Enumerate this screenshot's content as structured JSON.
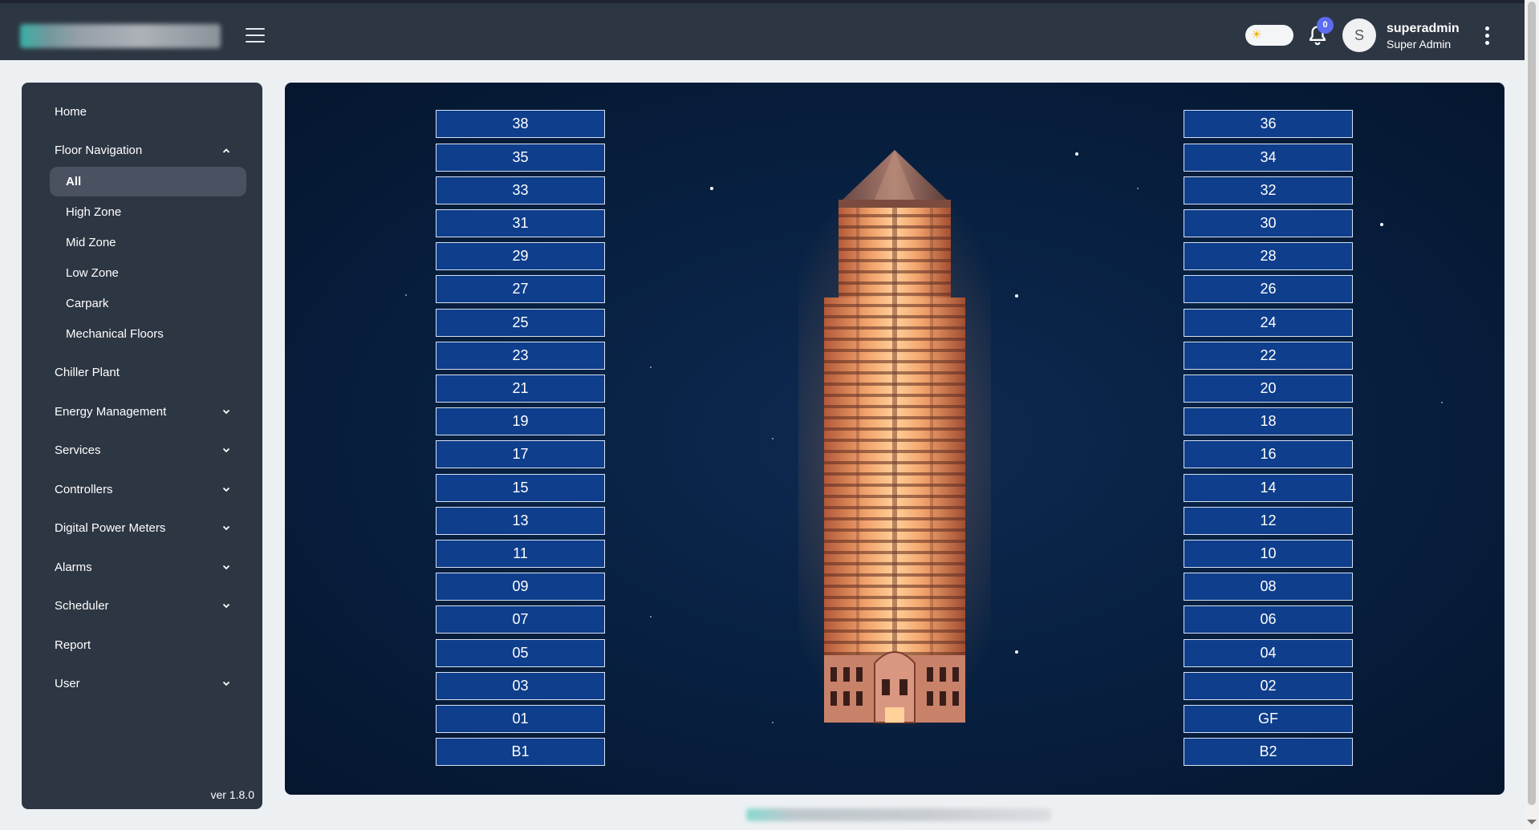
{
  "header": {
    "theme_toggle_icon": "sun-icon",
    "notifications": {
      "count": "0"
    },
    "user": {
      "initial": "S",
      "name": "superadmin",
      "role": "Super Admin"
    }
  },
  "sidebar": {
    "items": [
      {
        "label": "Home"
      },
      {
        "label": "Floor Navigation"
      },
      {
        "label": "Chiller Plant"
      },
      {
        "label": "Energy Management"
      },
      {
        "label": "Services"
      },
      {
        "label": "Controllers"
      },
      {
        "label": "Digital Power Meters"
      },
      {
        "label": "Alarms"
      },
      {
        "label": "Scheduler"
      },
      {
        "label": "Report"
      },
      {
        "label": "User"
      }
    ],
    "floor_nav_sub": [
      {
        "label": "All"
      },
      {
        "label": "High Zone"
      },
      {
        "label": "Mid Zone"
      },
      {
        "label": "Low Zone"
      },
      {
        "label": "Carpark"
      },
      {
        "label": "Mechanical Floors"
      }
    ],
    "version": "ver 1.8.0"
  },
  "floors": {
    "left": [
      "38",
      "35",
      "33",
      "31",
      "29",
      "27",
      "25",
      "23",
      "21",
      "19",
      "17",
      "15",
      "13",
      "11",
      "09",
      "07",
      "05",
      "03",
      "01",
      "B1"
    ],
    "right": [
      "36",
      "34",
      "32",
      "30",
      "28",
      "26",
      "24",
      "22",
      "20",
      "18",
      "16",
      "14",
      "12",
      "10",
      "08",
      "06",
      "04",
      "02",
      "GF",
      "B2"
    ]
  },
  "colors": {
    "topbar": "#2d3643",
    "sidebar": "#2d3643",
    "sidebar_active": "#4a5262",
    "main_bg": "#082142",
    "floor_button": "#0e3e8c",
    "badge": "#5b6cf0"
  }
}
